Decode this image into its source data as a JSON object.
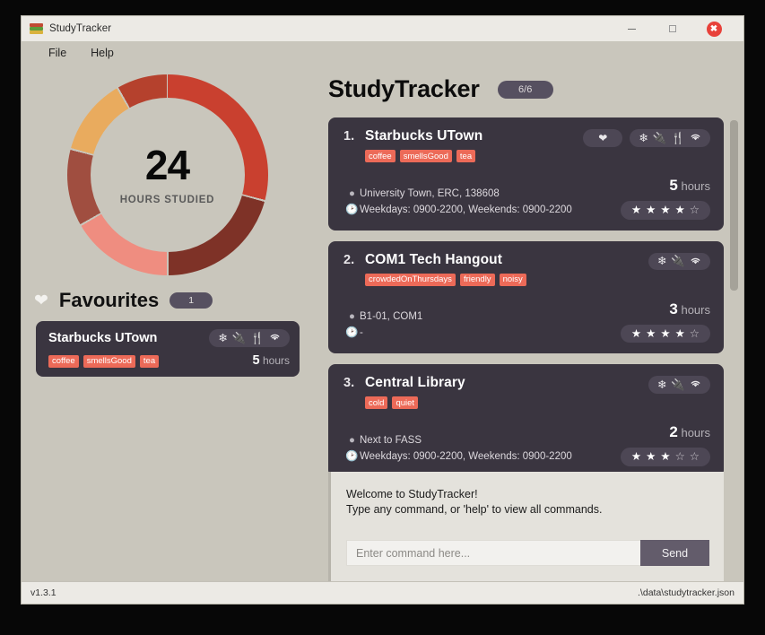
{
  "window": {
    "title": "StudyTracker",
    "app_icon": "books-icon",
    "controls": {
      "minimize": "minimize-icon",
      "restore": "restore-icon",
      "close": "✖"
    }
  },
  "menubar": {
    "items": [
      {
        "label": "File"
      },
      {
        "label": "Help"
      }
    ]
  },
  "stats": {
    "donut": {
      "value": "24",
      "label": "HOURS STUDIED"
    }
  },
  "favourites": {
    "heart_icon": "heart-icon",
    "title": "Favourites",
    "count": "1",
    "cards": [
      {
        "name": "Starbucks UTown",
        "tags": [
          "coffee",
          "smellsGood",
          "tea"
        ],
        "amenities": [
          "❄",
          "⚡",
          "🍴",
          "wifi"
        ],
        "hours_value": "5",
        "hours_unit": "hours"
      }
    ]
  },
  "header": {
    "title": "StudyTracker",
    "pill": "6/6"
  },
  "spots": [
    {
      "index": "1.",
      "name": "Starbucks UTown",
      "favourited": true,
      "heart_icon": "heart-icon",
      "tags": [
        "coffee",
        "smellsGood",
        "tea"
      ],
      "amenities": [
        "❄",
        "⚡",
        "🍴",
        "wifi"
      ],
      "location_icon": "map-pin-icon",
      "location": "University Town, ERC, 138608",
      "clock_icon": "clock-icon",
      "opening_hours": "Weekdays: 0900-2200, Weekends: 0900-2200",
      "hours_value": "5",
      "hours_unit": "hours",
      "rating": 4,
      "rating_max": 5
    },
    {
      "index": "2.",
      "name": "COM1 Tech Hangout",
      "favourited": false,
      "heart_icon": "heart-icon",
      "tags": [
        "crowdedOnThursdays",
        "friendly",
        "noisy"
      ],
      "amenities": [
        "❄",
        "⚡",
        "wifi"
      ],
      "location_icon": "map-pin-icon",
      "location": "B1-01, COM1",
      "clock_icon": "clock-icon",
      "opening_hours": "-",
      "hours_value": "3",
      "hours_unit": "hours",
      "rating": 4,
      "rating_max": 5
    },
    {
      "index": "3.",
      "name": "Central Library",
      "favourited": false,
      "heart_icon": "heart-icon",
      "tags": [
        "cold",
        "quiet"
      ],
      "amenities": [
        "❄",
        "⚡",
        "wifi"
      ],
      "location_icon": "map-pin-icon",
      "location": "Next to FASS",
      "clock_icon": "clock-icon",
      "opening_hours": "Weekdays: 0900-2200, Weekends: 0900-2200",
      "hours_value": "2",
      "hours_unit": "hours",
      "rating": 3,
      "rating_max": 5
    }
  ],
  "console": {
    "line1": "Welcome to StudyTracker!",
    "line2": "Type any command, or 'help' to view all commands.",
    "input_placeholder": "Enter command here...",
    "input_value": "",
    "send_label": "Send"
  },
  "statusbar": {
    "version": "v1.3.1",
    "file_path": ".\\data\\studytracker.json"
  },
  "colors": {
    "accent_tag": "#ec6a58",
    "card_bg": "#3a3540",
    "pill_bg": "#4d4755",
    "page_bg": "#c9c6bc",
    "send_btn": "#635c6b"
  },
  "chart_data": {
    "type": "pie",
    "title": "HOURS STUDIED",
    "center_value": 24,
    "total": 24,
    "values": [
      7,
      5,
      4,
      3,
      3,
      2
    ],
    "colors": [
      "#c9402f",
      "#7e3227",
      "#ef8d80",
      "#a04e40",
      "#e9ab5e",
      "#b5412d"
    ],
    "legend": "none",
    "grid": false
  }
}
